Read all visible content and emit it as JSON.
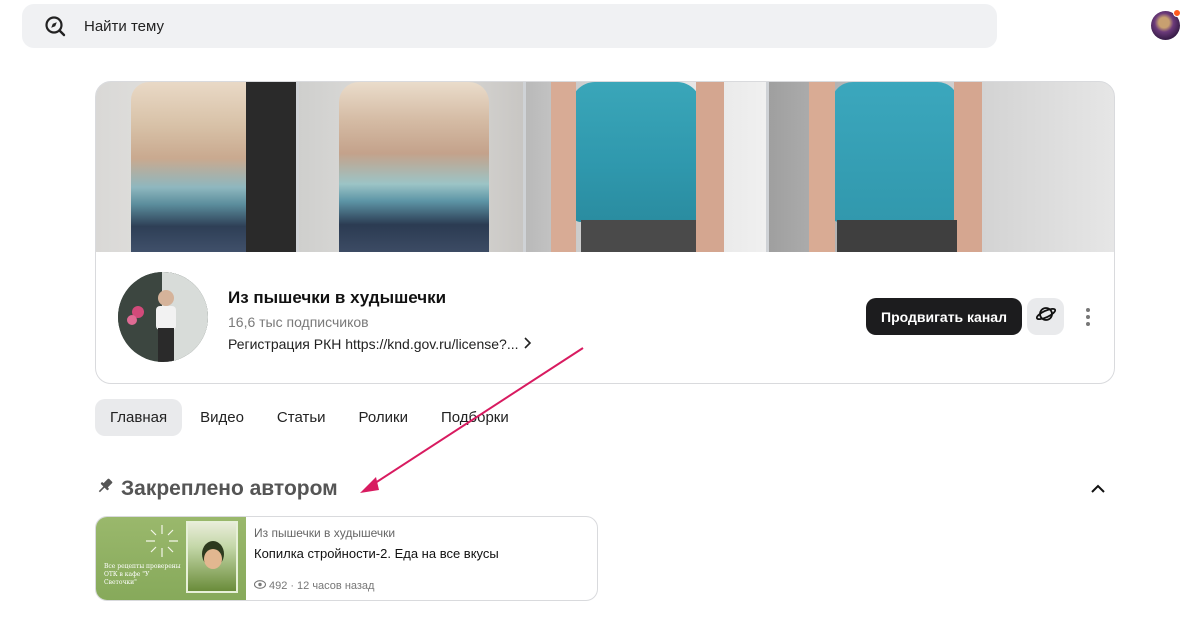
{
  "search": {
    "placeholder": "Найти тему",
    "icon": "compass-search-icon"
  },
  "user": {
    "avatar": "user-avatar",
    "notification_color": "#ff5a1f"
  },
  "channel": {
    "name": "Из пышечки в худышечки",
    "subscribers": "16,6 тыс подписчиков",
    "registration": "Регистрация РКН https://knd.gov.ru/license?...",
    "promote_label": "Продвигать канал",
    "promote_color": "#1c1c1e"
  },
  "tabs": [
    {
      "label": "Главная",
      "active": true
    },
    {
      "label": "Видео",
      "active": false
    },
    {
      "label": "Статьи",
      "active": false
    },
    {
      "label": "Ролики",
      "active": false
    },
    {
      "label": "Подборки",
      "active": false
    }
  ],
  "pinned": {
    "title": "Закреплено автором",
    "icon": "pin-icon",
    "arrow_color": "#d81b60",
    "video": {
      "channel": "Из пышечки в худышечки",
      "title": "Копилка стройности-2. Еда на все вкусы",
      "views": "492",
      "age": "12 часов назад",
      "thumb_text": "Все рецепты проверены ОТК в кафе \"У Светочки\""
    }
  }
}
